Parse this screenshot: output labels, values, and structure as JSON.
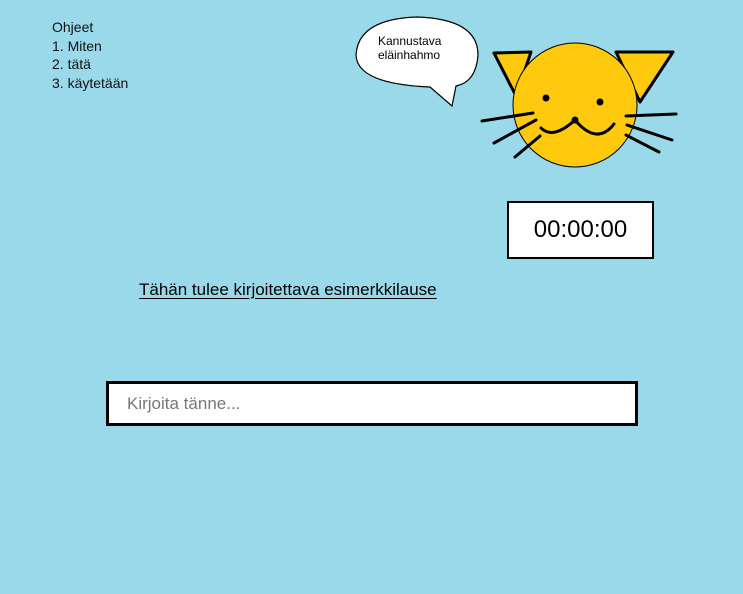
{
  "instructions": {
    "title": "Ohjeet",
    "items": [
      "1. Miten",
      "2. tätä",
      "3. käytetään"
    ]
  },
  "mascot": {
    "speech": "Kannustava eläinhahmo",
    "icon": "cat-face-icon"
  },
  "timer": {
    "value": "00:00:00"
  },
  "sentence": {
    "text": "Tähän tulee kirjoitettava esimerkkilause"
  },
  "input": {
    "placeholder": "Kirjoita tänne...",
    "value": ""
  },
  "colors": {
    "background": "#99d9ea",
    "cat": "#ffc90e"
  }
}
